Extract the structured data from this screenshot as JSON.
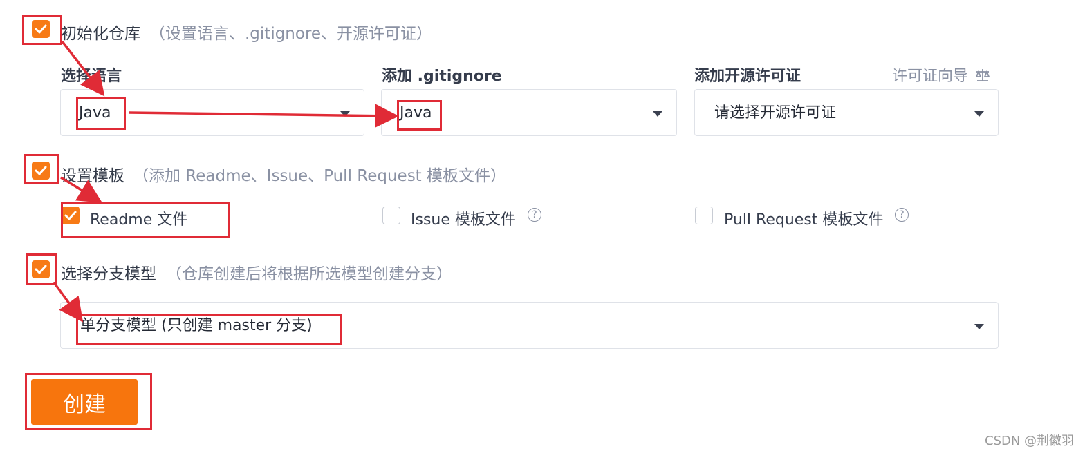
{
  "init_repo": {
    "checked": true,
    "label": "初始化仓库",
    "hint": "（设置语言、.gitignore、开源许可证）"
  },
  "language": {
    "label": "选择语言",
    "value": "Java"
  },
  "gitignore": {
    "label": "添加 .gitignore",
    "value": "Java"
  },
  "license": {
    "label": "添加开源许可证",
    "helper": "许可证向导",
    "helper_icon": "balance-scale-icon",
    "value": "请选择开源许可证"
  },
  "templates": {
    "checked": true,
    "label": "设置模板",
    "hint": "（添加 Readme、Issue、Pull Request 模板文件）",
    "options": [
      {
        "label": "Readme 文件",
        "checked": true
      },
      {
        "label": "Issue 模板文件",
        "checked": false,
        "help": "?"
      },
      {
        "label": "Pull Request 模板文件",
        "checked": false,
        "help": "?"
      }
    ]
  },
  "branch_model": {
    "checked": true,
    "label": "选择分支模型",
    "hint": "（仓库创建后将根据所选模型创建分支）",
    "value": "单分支模型 (只创建 master 分支)"
  },
  "create_button": {
    "label": "创建"
  },
  "watermark": "CSDN @荆徽羽",
  "colors": {
    "accent": "#f7750d",
    "annotation": "#e02b36"
  }
}
